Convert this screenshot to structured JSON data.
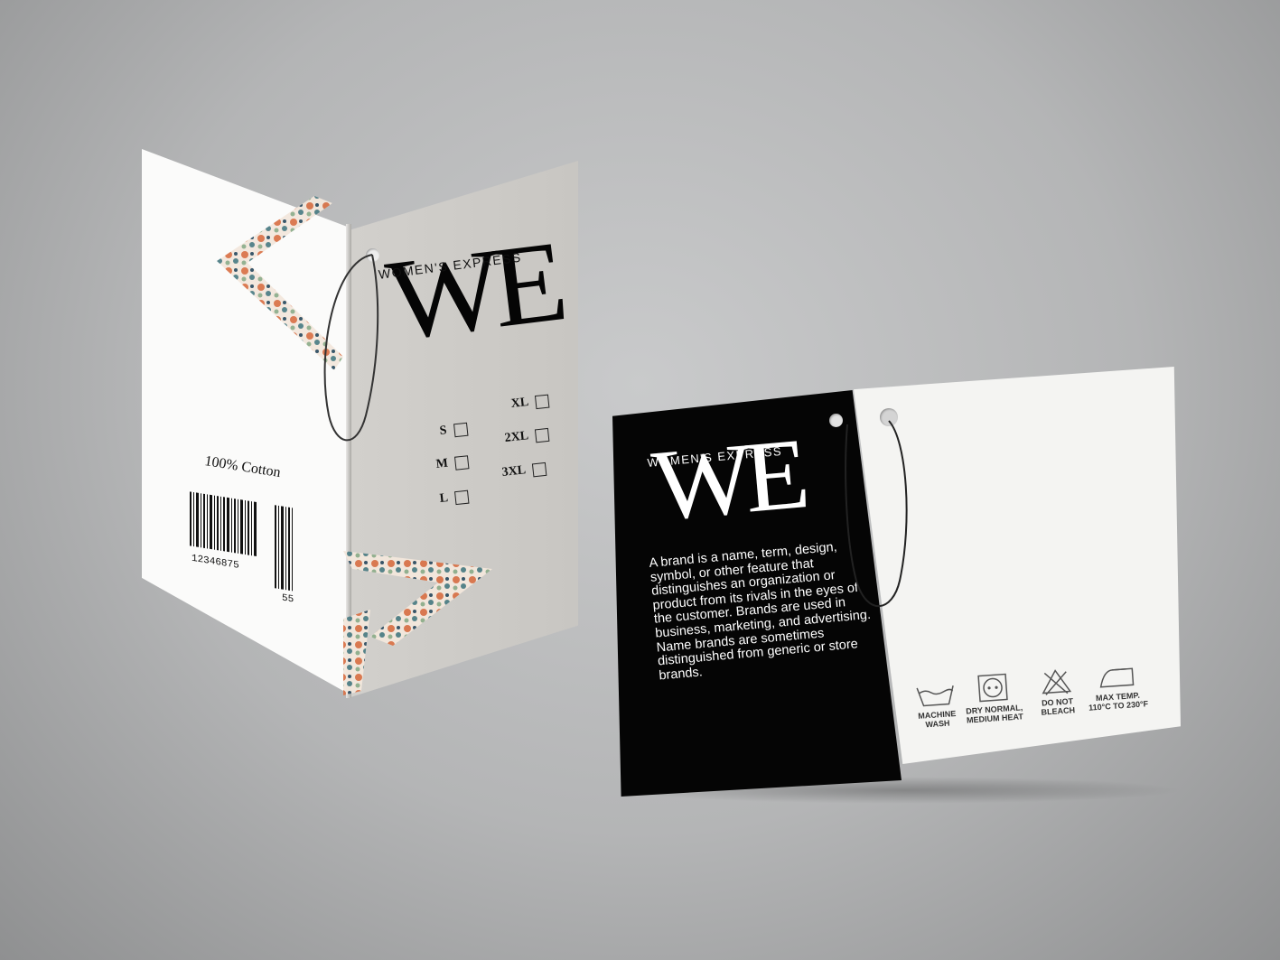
{
  "folded_tag": {
    "brand_subtitle": "WOMEN'S EXPRESS",
    "brand_logo": "WE",
    "material": "100% Cotton",
    "barcode_number": "12346875",
    "barcode_suffix": "55",
    "sizes_left": [
      "S",
      "M",
      "L"
    ],
    "sizes_right": [
      "XL",
      "2XL",
      "3XL"
    ]
  },
  "flat_tag": {
    "brand_subtitle": "WOMEN'S EXPRESS",
    "brand_logo": "WE",
    "description": "A brand is a name, term, design, symbol, or other feature that distinguishes an organization or product from its rivals in the eyes of the customer. Brands are used in business, marketing, and advertising. Name brands are sometimes distinguished from generic or store brands.",
    "care_instructions": [
      {
        "icon": "machine-wash-icon",
        "label": "MACHINE\nWASH"
      },
      {
        "icon": "tumble-dry-icon",
        "label": "DRY NORMAL,\nMEDIUM HEAT"
      },
      {
        "icon": "do-not-bleach-icon",
        "label": "DO NOT\nBLEACH"
      },
      {
        "icon": "iron-icon",
        "label": "MAX TEMP.\n110°C TO 230°F"
      }
    ]
  },
  "colors": {
    "background": "#b8b9ba",
    "tag_black": "#050505",
    "tag_grey": "#cbc9c5",
    "tag_white": "#f4f4f2",
    "floral_accent": "#d9744a"
  }
}
